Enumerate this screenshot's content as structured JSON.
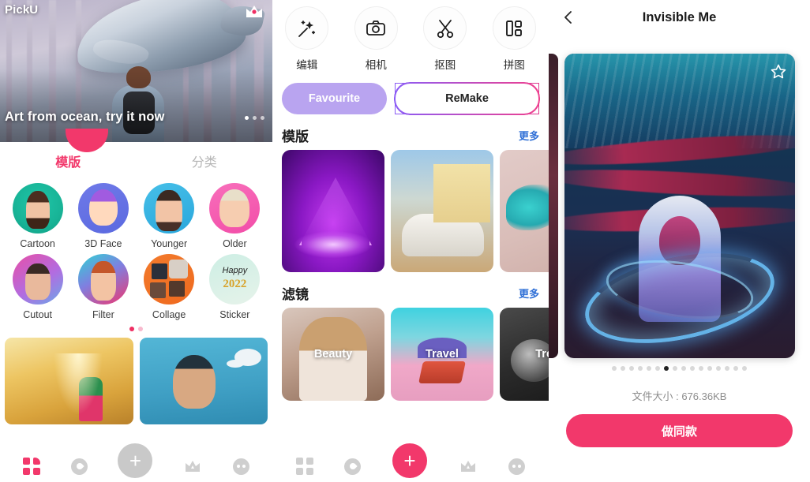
{
  "panel_left": {
    "app_name": "PickU",
    "crown_icon": "crown-icon",
    "hero": {
      "caption": "Art from ocean, try it now",
      "dots": 3,
      "active_dot": 0
    },
    "tabs": [
      {
        "label": "模版",
        "active": true
      },
      {
        "label": "分类",
        "active": false
      }
    ],
    "features": [
      {
        "label": "Cartoon"
      },
      {
        "label": "3D Face"
      },
      {
        "label": "Younger"
      },
      {
        "label": "Older"
      },
      {
        "label": "Cutout"
      },
      {
        "label": "Filter"
      },
      {
        "label": "Collage"
      },
      {
        "label": "Sticker"
      }
    ],
    "page_dots": {
      "count": 2,
      "active": 0
    },
    "bottom_cards": [
      {
        "name": "taj-mahal-template"
      },
      {
        "name": "comic-portrait-template"
      }
    ],
    "navbar": [
      {
        "icon": "grid-icon",
        "active": true
      },
      {
        "icon": "compass-icon",
        "active": false
      },
      {
        "icon": "plus-icon",
        "active": false
      },
      {
        "icon": "crown-icon",
        "active": false
      },
      {
        "icon": "face-icon",
        "active": false
      }
    ]
  },
  "panel_mid": {
    "tools": [
      {
        "label": "编辑",
        "icon": "magic-wand-icon"
      },
      {
        "label": "相机",
        "icon": "camera-icon"
      },
      {
        "label": "抠图",
        "icon": "scissors-icon"
      },
      {
        "label": "拼图",
        "icon": "collage-grid-icon"
      }
    ],
    "segments": [
      {
        "label": "Favourite",
        "active": true
      },
      {
        "label": "ReMake",
        "active": false
      }
    ],
    "sections": [
      {
        "title": "模版",
        "more": "更多",
        "cards": [
          {
            "label": "",
            "name": "neon-triangle-template"
          },
          {
            "label": "",
            "name": "vintage-car-template"
          },
          {
            "label": "",
            "name": "paint-splash-template"
          }
        ]
      },
      {
        "title": "滤镜",
        "more": "更多",
        "cards": [
          {
            "label": "Beauty",
            "name": "beauty-filter-card"
          },
          {
            "label": "Travel",
            "name": "travel-filter-card"
          },
          {
            "label": "Trend",
            "name": "trend-filter-card"
          }
        ]
      }
    ],
    "navbar": [
      {
        "icon": "grid-icon",
        "active": false
      },
      {
        "icon": "compass-icon",
        "active": false
      },
      {
        "icon": "plus-icon",
        "active": true
      },
      {
        "icon": "crown-icon",
        "active": false
      },
      {
        "icon": "face-icon",
        "active": false
      }
    ]
  },
  "panel_right": {
    "back_icon": "chevron-left-icon",
    "title": "Invisible Me",
    "favourite_icon": "star-outline-icon",
    "carousel": {
      "count": 16,
      "active": 6
    },
    "file_size_label": "文件大小 : 676.36KB",
    "cta_label": "做同款"
  },
  "colors": {
    "accent_pink": "#f2386b",
    "lavender": "#b9a4f0",
    "link_blue": "#2f6fd6",
    "muted_gray": "#8d8d8d"
  }
}
